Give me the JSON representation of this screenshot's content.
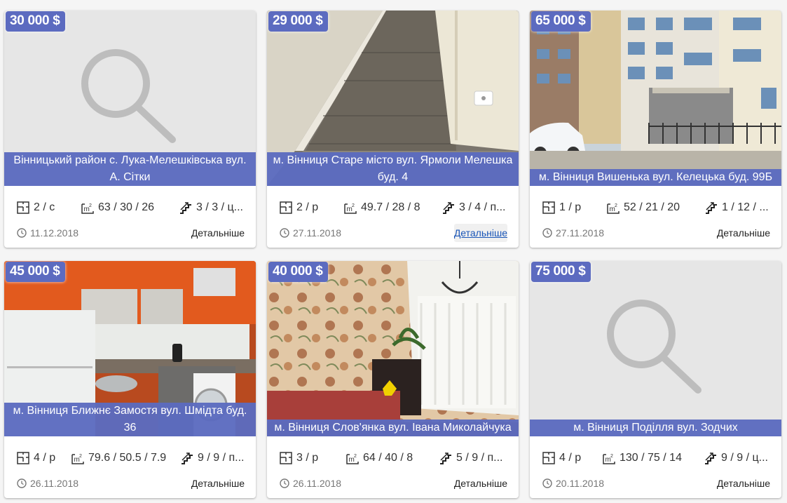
{
  "listings": [
    {
      "price": "30 000 $",
      "address": "Вінницький район с. Лука-Мелешківська вул. А. Сітки",
      "rooms": "2 / с",
      "area": "63 / 30 / 26",
      "floor": "3 / 3 / ц...",
      "date": "11.12.2018",
      "more": "Детальніше"
    },
    {
      "price": "29 000 $",
      "address": "м. Вінниця Старе місто вул. Ярмоли Мелешка буд. 4",
      "rooms": "2 / р",
      "area": "49.7 / 28 / 8",
      "floor": "3 / 4 / п...",
      "date": "27.11.2018",
      "more": "Детальніше"
    },
    {
      "price": "65 000 $",
      "address": "м. Вінниця Вишенька вул. Келецька буд. 99Б",
      "rooms": "1 / р",
      "area": "52 / 21 / 20",
      "floor": "1 / 12 / ...",
      "date": "27.11.2018",
      "more": "Детальніше"
    },
    {
      "price": "45 000 $",
      "address": "м. Вінниця Ближнє Замостя вул. Шмідта буд. 36",
      "rooms": "4 / р",
      "area": "79.6 / 50.5 / 7.9",
      "floor": "9 / 9 / п...",
      "date": "26.11.2018",
      "more": "Детальніше"
    },
    {
      "price": "40 000 $",
      "address": "м. Вінниця Слов'янка вул. Івана Миколайчука",
      "rooms": "3 / р",
      "area": "64 / 40 / 8",
      "floor": "5 / 9 / п...",
      "date": "26.11.2018",
      "more": "Детальніше"
    },
    {
      "price": "75 000 $",
      "address": "м. Вінниця Поділля вул. Зодчих",
      "rooms": "4 / р",
      "area": "130 / 75 / 14",
      "floor": "9 / 9 / ц...",
      "date": "20.11.2018",
      "more": "Детальніше"
    }
  ],
  "photos": [
    "placeholder-search",
    "hallway-laminate",
    "apartment-building",
    "kitchen-orange",
    "room-floral-wallpaper",
    "placeholder-search"
  ],
  "colors": {
    "accent": "#5c6bc0",
    "link_hover": "#1a56b8"
  }
}
